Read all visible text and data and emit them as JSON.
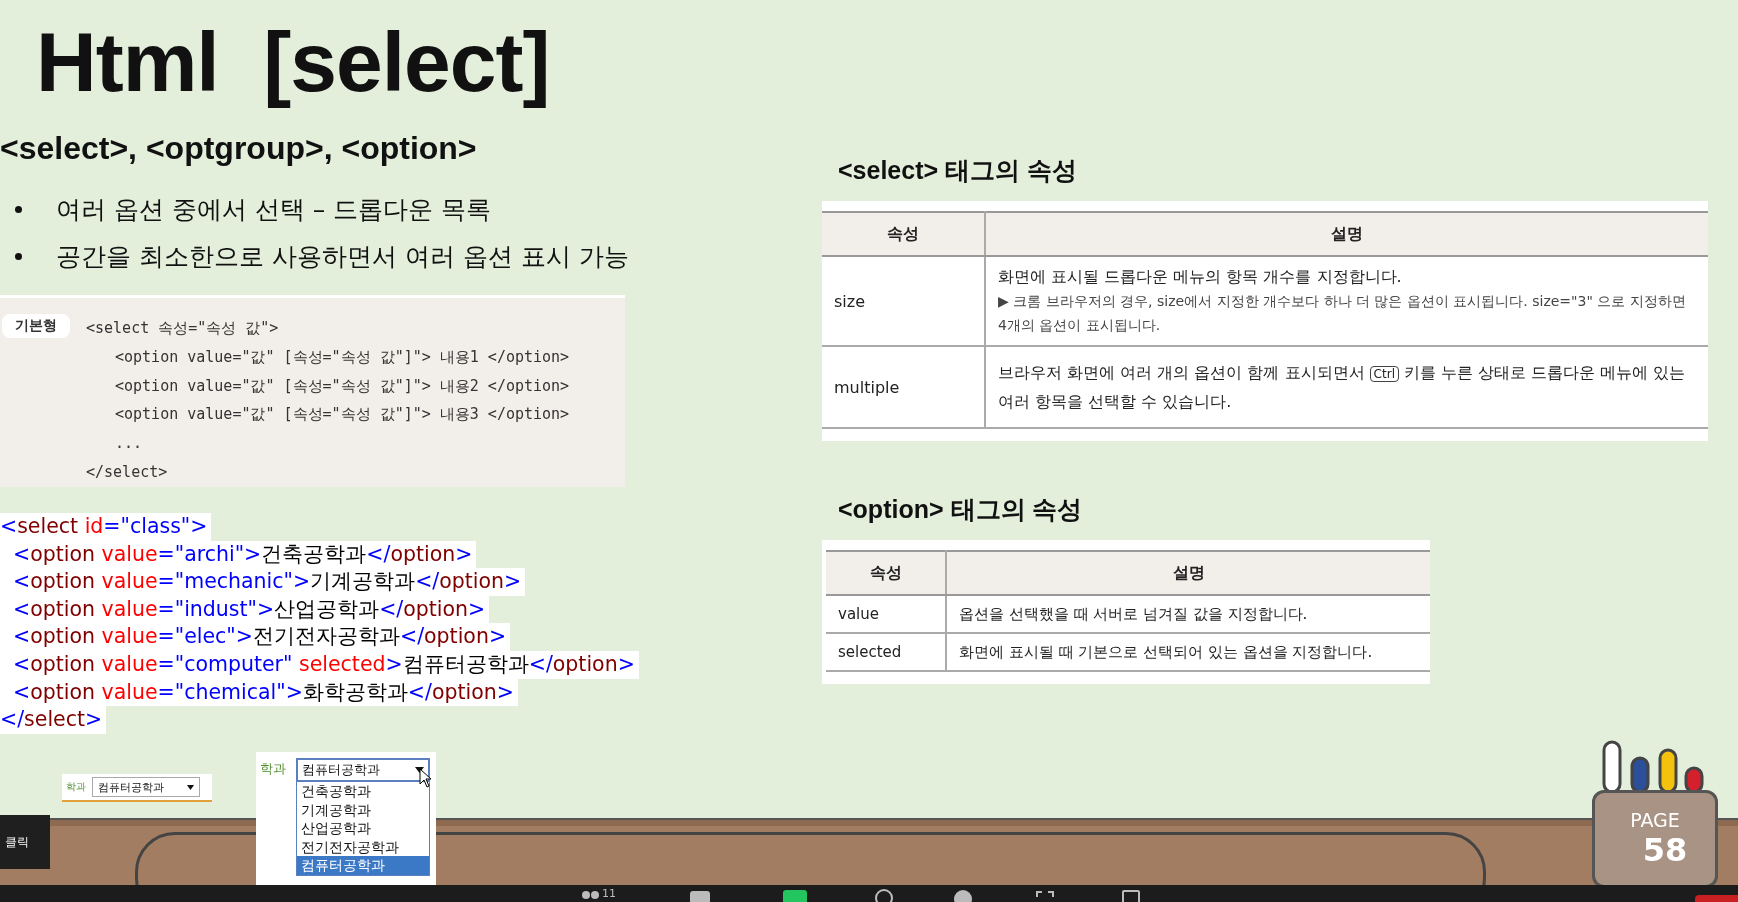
{
  "title": "Html  [select]",
  "subtitle": "<select>, <optgroup>, <option>",
  "bullets": [
    "여러 옵션 중에서 선택 – 드롭다운 목록",
    "공간을 최소한으로 사용하면서 여러 옵션 표시 가능"
  ],
  "syntax_box": {
    "badge": "기본형",
    "lines": [
      {
        "indent": false,
        "text": "<select 속성=\"속성 값\">"
      },
      {
        "indent": true,
        "text": "<option value=\"값\" [속성=\"속성 값\"]\"> 내용1 </option>"
      },
      {
        "indent": true,
        "text": "<option value=\"값\" [속성=\"속성 값\"]\"> 내용2 </option>"
      },
      {
        "indent": true,
        "text": "<option value=\"값\" [속성=\"속성 값\"]\"> 내용3 </option>"
      },
      {
        "indent": true,
        "text": "..."
      },
      {
        "indent": false,
        "text": "</select>"
      }
    ]
  },
  "code": [
    [
      {
        "kind": "punct",
        "text": "<"
      },
      {
        "kind": "tag",
        "text": "select"
      },
      {
        "kind": "attr",
        "text": " id"
      },
      {
        "kind": "punct",
        "text": "=\"class\">"
      }
    ],
    [
      {
        "kind": "punct",
        "text": "  <"
      },
      {
        "kind": "tag",
        "text": "option"
      },
      {
        "kind": "attr",
        "text": " value"
      },
      {
        "kind": "punct",
        "text": "=\"archi\">"
      },
      {
        "kind": "text",
        "text": "건축공학과"
      },
      {
        "kind": "punct",
        "text": "</"
      },
      {
        "kind": "tag",
        "text": "option"
      },
      {
        "kind": "punct",
        "text": ">"
      }
    ],
    [
      {
        "kind": "punct",
        "text": "  <"
      },
      {
        "kind": "tag",
        "text": "option"
      },
      {
        "kind": "attr",
        "text": " value"
      },
      {
        "kind": "punct",
        "text": "=\"mechanic\">"
      },
      {
        "kind": "text",
        "text": "기계공학과"
      },
      {
        "kind": "punct",
        "text": "</"
      },
      {
        "kind": "tag",
        "text": "option"
      },
      {
        "kind": "punct",
        "text": ">"
      }
    ],
    [
      {
        "kind": "punct",
        "text": "  <"
      },
      {
        "kind": "tag",
        "text": "option"
      },
      {
        "kind": "attr",
        "text": " value"
      },
      {
        "kind": "punct",
        "text": "=\"indust\">"
      },
      {
        "kind": "text",
        "text": "산업공학과"
      },
      {
        "kind": "punct",
        "text": "</"
      },
      {
        "kind": "tag",
        "text": "option"
      },
      {
        "kind": "punct",
        "text": ">"
      }
    ],
    [
      {
        "kind": "punct",
        "text": "  <"
      },
      {
        "kind": "tag",
        "text": "option"
      },
      {
        "kind": "attr",
        "text": " value"
      },
      {
        "kind": "punct",
        "text": "=\"elec\">"
      },
      {
        "kind": "text",
        "text": "전기전자공학과"
      },
      {
        "kind": "punct",
        "text": "</"
      },
      {
        "kind": "tag",
        "text": "option"
      },
      {
        "kind": "punct",
        "text": ">"
      }
    ],
    [
      {
        "kind": "punct",
        "text": "  <"
      },
      {
        "kind": "tag",
        "text": "option"
      },
      {
        "kind": "attr",
        "text": " value"
      },
      {
        "kind": "punct",
        "text": "=\"computer\""
      },
      {
        "kind": "attr",
        "text": " selected"
      },
      {
        "kind": "punct",
        "text": ">"
      },
      {
        "kind": "text",
        "text": "컴퓨터공학과"
      },
      {
        "kind": "punct",
        "text": "</"
      },
      {
        "kind": "tag",
        "text": "option"
      },
      {
        "kind": "punct",
        "text": ">"
      }
    ],
    [
      {
        "kind": "punct",
        "text": "  <"
      },
      {
        "kind": "tag",
        "text": "option"
      },
      {
        "kind": "attr",
        "text": " value"
      },
      {
        "kind": "punct",
        "text": "=\"chemical\">"
      },
      {
        "kind": "text",
        "text": "화학공학과"
      },
      {
        "kind": "punct",
        "text": "</"
      },
      {
        "kind": "tag",
        "text": "option"
      },
      {
        "kind": "punct",
        "text": ">"
      }
    ],
    [
      {
        "kind": "punct",
        "text": "</"
      },
      {
        "kind": "tag",
        "text": "select"
      },
      {
        "kind": "punct",
        "text": ">"
      }
    ]
  ],
  "select_table": {
    "heading": "<select> 태그의 속성",
    "columns": [
      "속성",
      "설명"
    ],
    "rows": [
      {
        "name": "size",
        "description": "화면에 표시될 드롭다운 메뉴의 항목 개수를 지정합니다.",
        "note": "▶ 크롬 브라우저의 경우, size에서 지정한 개수보다 하나 더 많은 옵션이 표시됩니다. size=\"3\" 으로 지정하면 4개의 옵션이 표시됩니다."
      },
      {
        "name": "multiple",
        "before": "브라우저 화면에 여러 개의 옵션이 함께 표시되면서",
        "key": "Ctrl",
        "after": "키를 누른 상태로 드롭다운 메뉴에 있는 여러 항목을 선택할 수 있습니다."
      }
    ]
  },
  "option_table": {
    "heading": "<option> 태그의 속성",
    "columns": [
      "속성",
      "설명"
    ],
    "rows": [
      {
        "name": "value",
        "description": "옵션을 선택했을 때 서버로 넘겨질 값을 지정합니다."
      },
      {
        "name": "selected",
        "description": "화면에 표시될 때 기본으로 선택되어 있는 옵션을 지정합니다."
      }
    ]
  },
  "demo_closed": {
    "label": "학과",
    "value": "컴퓨터공학과"
  },
  "demo_open": {
    "label": "학과",
    "value": "컴퓨터공학과",
    "options": [
      {
        "text": "건축공학과",
        "selected": false
      },
      {
        "text": "기계공학과",
        "selected": false
      },
      {
        "text": "산업공학과",
        "selected": false
      },
      {
        "text": "전기전자공학과",
        "selected": false
      },
      {
        "text": "컴퓨터공학과",
        "selected": true
      }
    ]
  },
  "click_label": "클릭",
  "page": {
    "label": "PAGE",
    "number": "58"
  },
  "taskbar": {
    "participants": "11"
  }
}
